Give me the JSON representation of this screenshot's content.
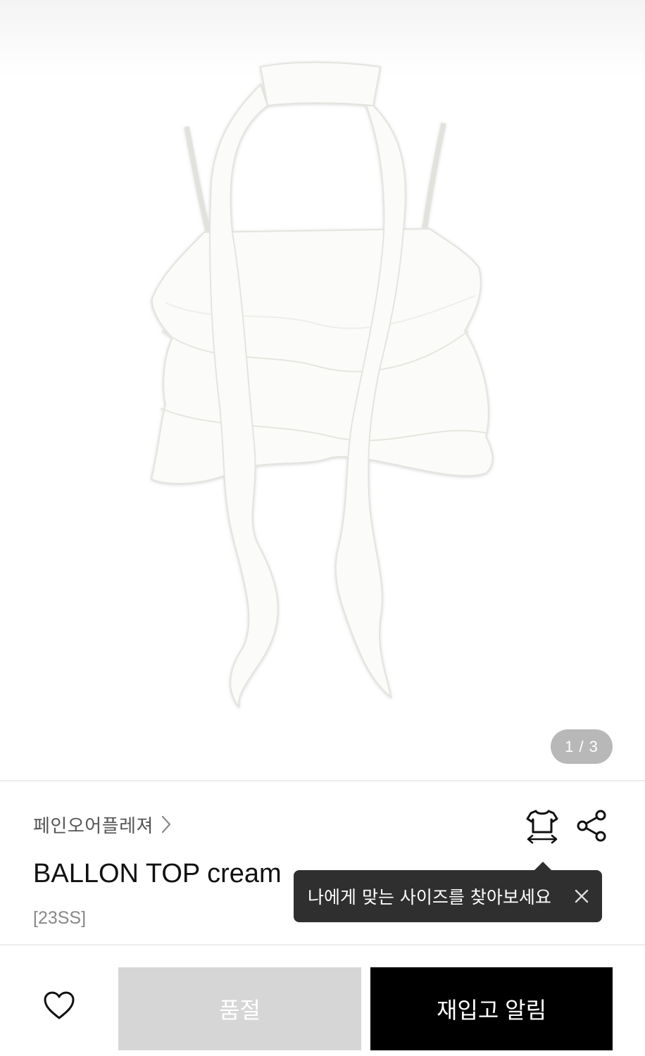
{
  "gallery": {
    "image_alt": "BALLON TOP cream",
    "counter": "1 / 3"
  },
  "product": {
    "brand": "페인오어플레져",
    "title": "BALLON TOP cream",
    "season": "[23SS]"
  },
  "icons": {
    "brand_chevron": "chevron-right-icon",
    "size_guide": "shirt-size-icon",
    "share": "share-icon",
    "tooltip_close": "close-icon",
    "wishlist": "heart-icon"
  },
  "tooltip": {
    "text": "나에게 맞는 사이즈를 찾아보세요"
  },
  "actions": {
    "soldout_label": "품절",
    "restock_label": "재입고 알림"
  },
  "colors": {
    "soldout_bg": "#d6d6d6",
    "restock_bg": "#000000",
    "tooltip_bg": "#2f2f2f"
  }
}
